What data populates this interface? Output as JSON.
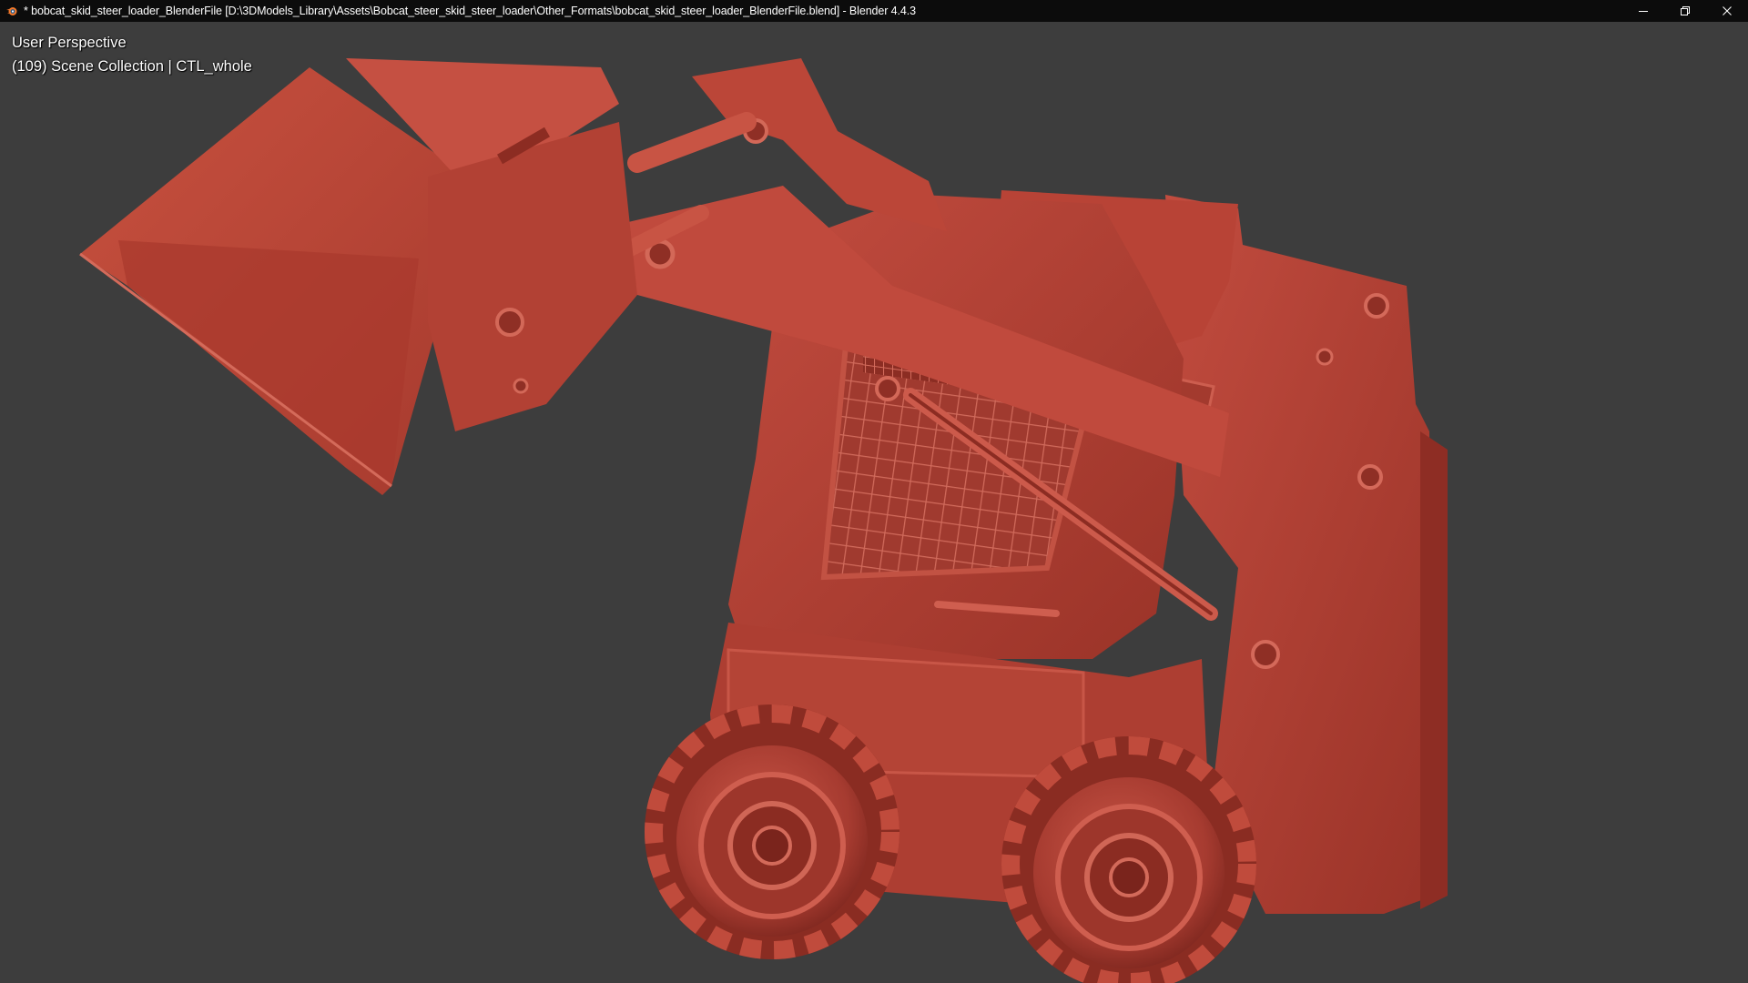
{
  "window": {
    "title": "* bobcat_skid_steer_loader_BlenderFile [D:\\3DModels_Library\\Assets\\Bobcat_steer_skid_steer_loader\\Other_Formats\\bobcat_skid_steer_loader_BlenderFile.blend] - Blender 4.4.3",
    "app_icon": "blender-logo-icon",
    "controls": {
      "minimize_icon": "minimize-icon",
      "restore_icon": "restore-icon",
      "close_icon": "close-icon"
    }
  },
  "viewport": {
    "view_label": "User Perspective",
    "collection_label": "(109) Scene Collection | CTL_whole",
    "background_color": "#3d3d3d",
    "model_color": "#b9453a",
    "object": "bobcat skid steer loader (clay render)"
  }
}
